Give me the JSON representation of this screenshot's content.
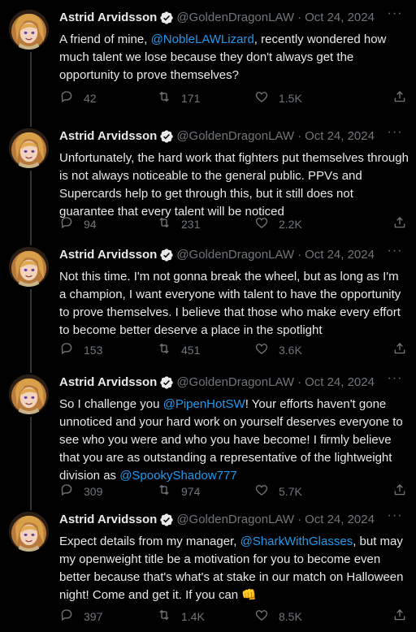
{
  "author": {
    "name": "Astrid Arvidsson",
    "handle": "@GoldenDragonLAW",
    "separator": "·",
    "date": "Oct 24, 2024"
  },
  "more_label": "···",
  "tweets": [
    {
      "parts": [
        {
          "t": "A friend of mine, "
        },
        {
          "t": "@NobleLAWLizard",
          "m": true
        },
        {
          "t": ", recently wondered how much talent we lose because they don't always get the opportunity to prove themselves?"
        }
      ],
      "replies": "42",
      "reposts": "171",
      "likes": "1.5K"
    },
    {
      "parts": [
        {
          "t": "Unfortunately, the hard work that fighters put themselves through is not always noticeable to the general public. PPVs and Supercards help to get through this, but it still does not guarantee that every talent will be noticed"
        }
      ],
      "replies": "94",
      "reposts": "231",
      "likes": "2.2K"
    },
    {
      "parts": [
        {
          "t": "Not this time. I'm not gonna break the wheel, but as long as I'm a champion, I want everyone with talent to have the opportunity to prove themselves. I believe that those who make every effort to become better deserve a place in the spotlight"
        }
      ],
      "replies": "153",
      "reposts": "451",
      "likes": "3.6K"
    },
    {
      "parts": [
        {
          "t": "So I challenge you "
        },
        {
          "t": "@PipenHotSW",
          "m": true
        },
        {
          "t": "! Your efforts haven't gone unnoticed and your hard work on yourself deserves everyone to see who you were and who you have become! I firmly believe that you are as outstanding a representative of the lightweight division as "
        },
        {
          "t": "@SpookyShadow777",
          "m": true
        }
      ],
      "replies": "309",
      "reposts": "974",
      "likes": "5.7K"
    },
    {
      "parts": [
        {
          "t": "Expect details from my manager, "
        },
        {
          "t": "@SharkWithGlasses",
          "m": true
        },
        {
          "t": ", but may my openweight title be a motivation for you to become even better because that's what's at stake in our match on Halloween night! Come and get it. If you can 👊"
        }
      ],
      "replies": "397",
      "reposts": "1.4K",
      "likes": "8.5K"
    }
  ],
  "colors": {
    "background": "#000000",
    "text": "#e7e9ea",
    "muted": "#71767b",
    "link": "#1d9bf0",
    "thread_line": "#333639"
  },
  "icons": [
    "verified-badge-icon",
    "more-icon",
    "reply-icon",
    "repost-icon",
    "like-icon",
    "share-icon"
  ]
}
